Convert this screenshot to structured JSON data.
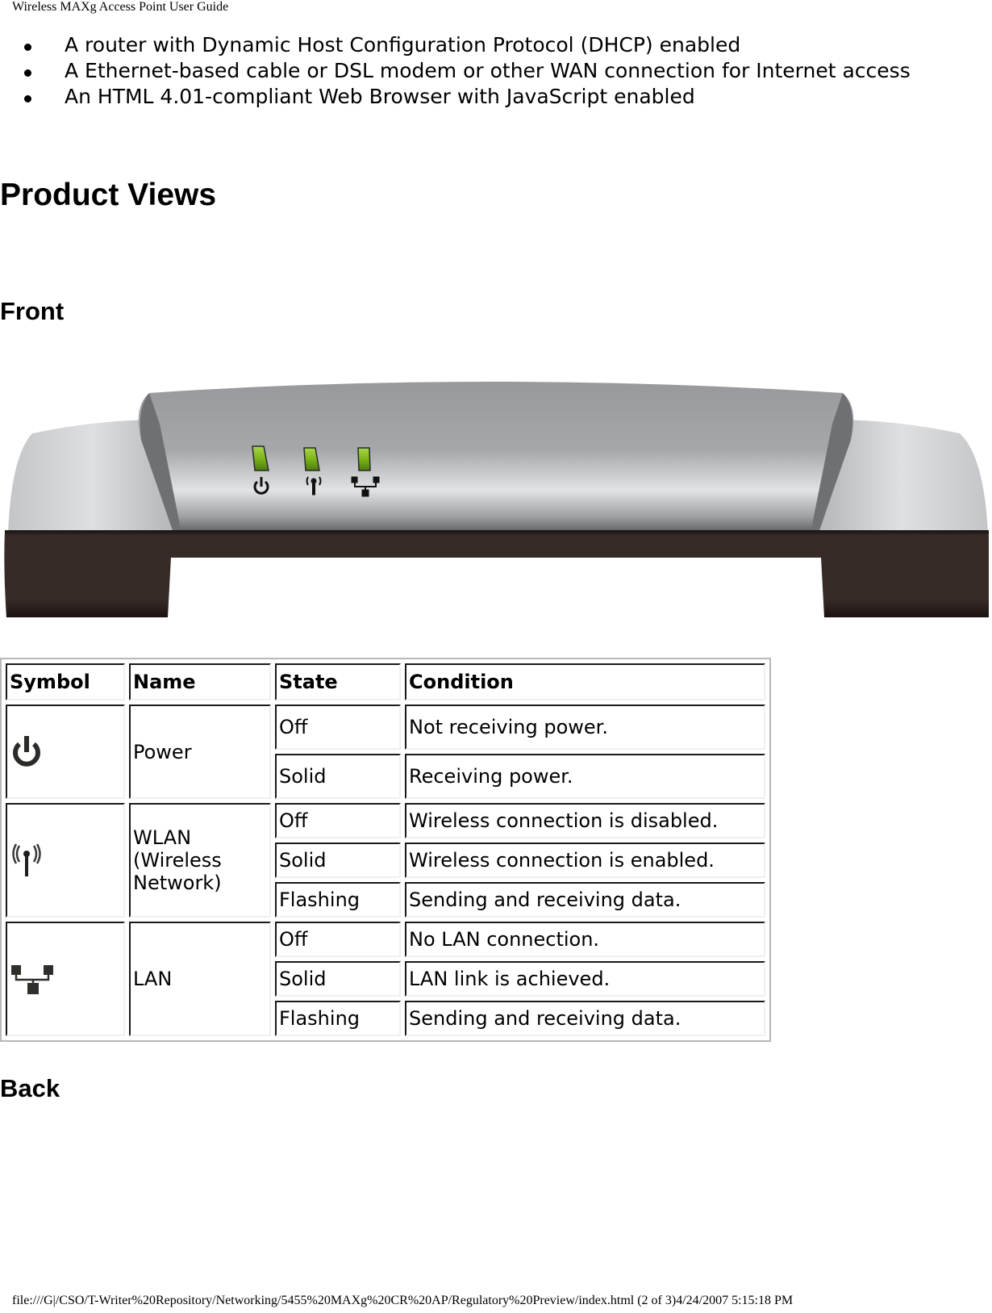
{
  "header": {
    "title": "Wireless MAXg Access Point User Guide"
  },
  "requirements": [
    "A router with Dynamic Host Configuration Protocol (DHCP) enabled",
    "A Ethernet-based cable or DSL modem or other WAN connection for Internet access",
    "An HTML 4.01-compliant Web Browser with JavaScript enabled"
  ],
  "section_title": "Product Views",
  "front": {
    "heading": "Front",
    "image": {
      "description": "Front view of access point with three green LEDs",
      "leds": [
        "power-icon",
        "wlan-icon",
        "lan-icon"
      ],
      "led_color": "#7cb518"
    }
  },
  "led_table": {
    "headers": [
      "Symbol",
      "Name",
      "State",
      "Condition"
    ],
    "groups": [
      {
        "icon": "power-icon",
        "name": "Power",
        "rows": [
          {
            "state": "Off",
            "condition": "Not receiving power."
          },
          {
            "state": "Solid",
            "condition": "Receiving power."
          }
        ]
      },
      {
        "icon": "wlan-icon",
        "name": "WLAN (Wireless Network)",
        "rows": [
          {
            "state": "Off",
            "condition": "Wireless connection is disabled."
          },
          {
            "state": "Solid",
            "condition": "Wireless connection is enabled."
          },
          {
            "state": "Flashing",
            "condition": "Sending and receiving data."
          }
        ]
      },
      {
        "icon": "lan-icon",
        "name": "LAN",
        "rows": [
          {
            "state": "Off",
            "condition": "No LAN connection."
          },
          {
            "state": "Solid",
            "condition": "LAN link is achieved."
          },
          {
            "state": "Flashing",
            "condition": "Sending and receiving data."
          }
        ]
      }
    ]
  },
  "back": {
    "heading": "Back"
  },
  "footer": {
    "text": "file:///G|/CSO/T-Writer%20Repository/Networking/5455%20MAXg%20CR%20AP/Regulatory%20Preview/index.html (2 of 3)4/24/2007 5:15:18 PM"
  }
}
